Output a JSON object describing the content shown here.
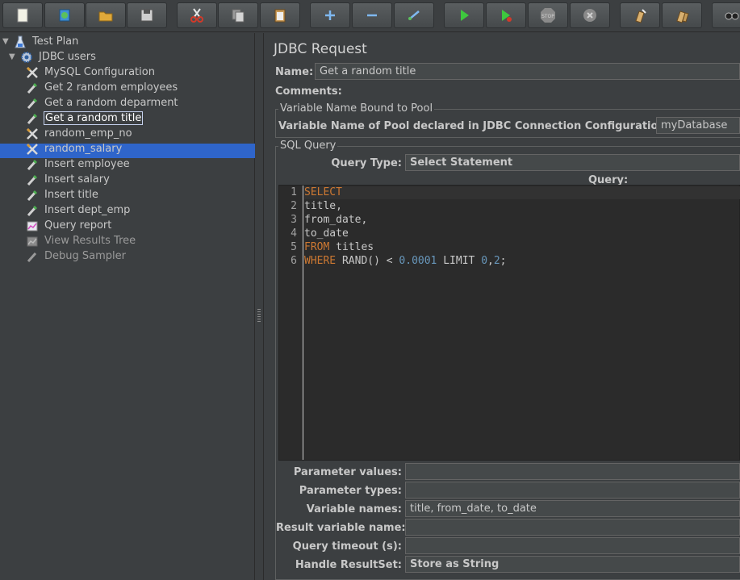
{
  "toolbar": {
    "buttons": [
      {
        "name": "new-icon"
      },
      {
        "name": "templates-icon"
      },
      {
        "name": "open-icon"
      },
      {
        "name": "save-icon"
      },
      {
        "name": "cut-icon"
      },
      {
        "name": "copy-icon"
      },
      {
        "name": "paste-icon"
      },
      {
        "name": "expand-icon"
      },
      {
        "name": "collapse-icon"
      },
      {
        "name": "toggle-icon"
      },
      {
        "name": "start-icon"
      },
      {
        "name": "start-no-pauses-icon"
      },
      {
        "name": "stop-icon"
      },
      {
        "name": "shutdown-icon"
      },
      {
        "name": "clear-icon"
      },
      {
        "name": "clear-all-icon"
      },
      {
        "name": "search-icon"
      }
    ],
    "stop_text": "STOP"
  },
  "tree": {
    "items": [
      {
        "label": "Test Plan",
        "icon": "test-plan-icon",
        "expanded": true
      },
      {
        "label": "JDBC users",
        "icon": "thread-group-icon",
        "expanded": true
      },
      {
        "label": "MySQL Configuration",
        "icon": "config-element-icon"
      },
      {
        "label": "Get 2 random employees",
        "icon": "sampler-icon"
      },
      {
        "label": "Get a random deparment",
        "icon": "sampler-icon"
      },
      {
        "label": "Get a random title",
        "icon": "sampler-icon",
        "selected": true
      },
      {
        "label": "random_emp_no",
        "icon": "config-element-icon"
      },
      {
        "label": "random_salary",
        "icon": "config-element-icon"
      },
      {
        "label": "Insert employee",
        "icon": "sampler-icon"
      },
      {
        "label": "Insert salary",
        "icon": "sampler-icon"
      },
      {
        "label": "Insert title",
        "icon": "sampler-icon"
      },
      {
        "label": "Insert dept_emp",
        "icon": "sampler-icon"
      },
      {
        "label": "Query report",
        "icon": "report-icon"
      },
      {
        "label": "View Results Tree",
        "icon": "listener-icon",
        "disabled": true
      },
      {
        "label": "Debug Sampler",
        "icon": "sampler-icon",
        "disabled": true
      }
    ]
  },
  "panel": {
    "title": "JDBC Request",
    "name_label": "Name:",
    "name_value": "Get a random title",
    "comments_label": "Comments:",
    "pool_group_title": "Variable Name Bound to Pool",
    "pool_label": "Variable Name of Pool declared in JDBC Connection Configuration:",
    "pool_value": "myDatabase",
    "sql_group_title": "SQL Query",
    "query_type_label": "Query Type:",
    "query_type_value": "Select Statement",
    "query_label": "Query:",
    "code_lines": [
      {
        "n": "1",
        "tokens": [
          [
            "kw",
            "SELECT"
          ]
        ]
      },
      {
        "n": "2",
        "tokens": [
          [
            "",
            "title,"
          ]
        ]
      },
      {
        "n": "3",
        "tokens": [
          [
            "",
            "from_date,"
          ]
        ]
      },
      {
        "n": "4",
        "tokens": [
          [
            "",
            "to_date"
          ]
        ]
      },
      {
        "n": "5",
        "tokens": [
          [
            "kw",
            "FROM"
          ],
          [
            "",
            " titles"
          ]
        ]
      },
      {
        "n": "6",
        "tokens": [
          [
            "kw",
            "WHERE"
          ],
          [
            "",
            " RAND() < "
          ],
          [
            "num",
            "0.0001"
          ],
          [
            "",
            " LIMIT "
          ],
          [
            "num",
            "0"
          ],
          [
            "",
            ","
          ],
          [
            "num",
            "2"
          ],
          [
            "",
            ";"
          ]
        ]
      }
    ],
    "param_values_label": "Parameter values:",
    "param_values": "",
    "param_types_label": "Parameter types:",
    "param_types": "",
    "var_names_label": "Variable names:",
    "var_names": "title, from_date, to_date",
    "result_var_label": "Result variable name:",
    "result_var": "",
    "timeout_label": "Query timeout (s):",
    "timeout": "",
    "handle_rs_label": "Handle ResultSet:",
    "handle_rs_value": "Store as String"
  },
  "colors": {
    "background": "#3c3f41",
    "selection": "#2f65ca",
    "keyword": "#cc7832",
    "number": "#6897bb",
    "editor_bg": "#2b2b2b"
  }
}
